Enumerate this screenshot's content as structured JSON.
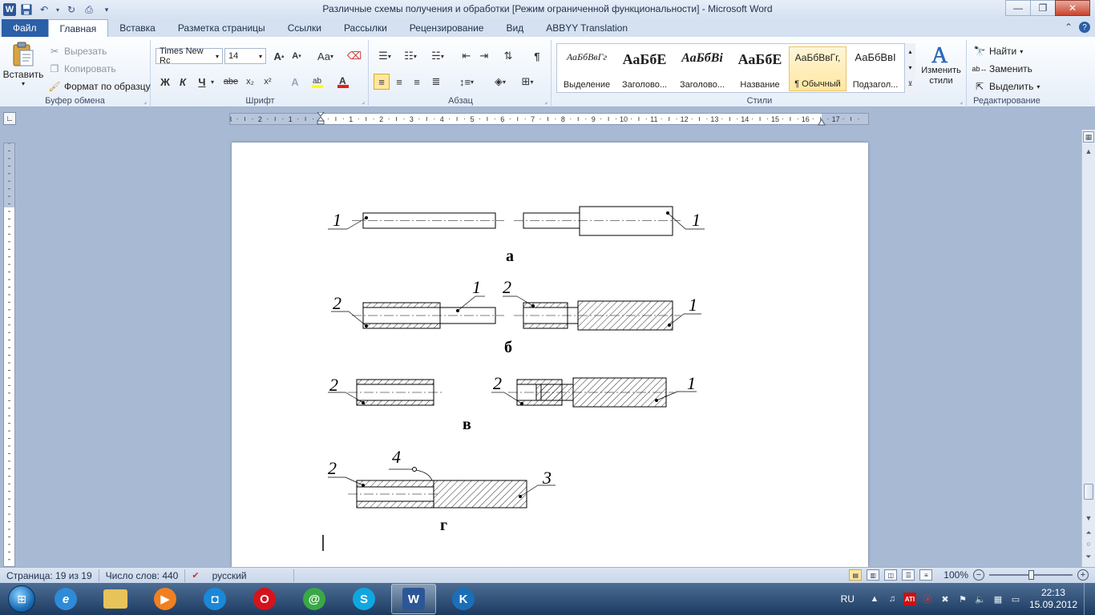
{
  "window": {
    "title": "Различные схемы получения и обработки [Режим ограниченной функциональности]  -  Microsoft Word",
    "app_icon_letter": "W",
    "controls": {
      "minimize": "—",
      "maximize": "❐",
      "close": "✕"
    }
  },
  "tabs": {
    "file": "Файл",
    "items": [
      "Главная",
      "Вставка",
      "Разметка страницы",
      "Ссылки",
      "Рассылки",
      "Рецензирование",
      "Вид",
      "ABBYY Translation"
    ],
    "active": "Главная"
  },
  "ribbon": {
    "clipboard": {
      "label": "Буфер обмена",
      "paste": "Вставить",
      "cut": "Вырезать",
      "copy": "Копировать",
      "format_painter": "Формат по образцу"
    },
    "font": {
      "label": "Шрифт",
      "font_name": "Times New Rc",
      "font_size": "14",
      "grow": "A",
      "shrink": "A",
      "case": "Aa",
      "bold": "Ж",
      "italic": "К",
      "underline": "Ч",
      "strike": "abe",
      "subscript": "x₂",
      "superscript": "x²"
    },
    "paragraph": {
      "label": "Абзац"
    },
    "styles": {
      "label": "Стили",
      "items": [
        {
          "preview": "АаБбВвГг",
          "name": "Выделение"
        },
        {
          "preview": "АаБбЕ",
          "name": "Заголово..."
        },
        {
          "preview": "АаБбВі",
          "name": "Заголово..."
        },
        {
          "preview": "АаБбЕ",
          "name": "Название"
        },
        {
          "preview": "АаБбВвГг,",
          "name": "¶ Обычный"
        },
        {
          "preview": "АаБбВвІ",
          "name": "Подзагол..."
        }
      ],
      "change_styles": "Изменить стили"
    },
    "editing": {
      "label": "Редактирование",
      "find": "Найти",
      "replace": "Заменить",
      "select": "Выделить"
    }
  },
  "ruler": {
    "numbers": [
      "3",
      "2",
      "1",
      "1",
      "2",
      "3",
      "4",
      "5",
      "6",
      "7",
      "8",
      "9",
      "10",
      "11",
      "12",
      "13",
      "14",
      "15",
      "16",
      "17"
    ]
  },
  "document": {
    "labels": {
      "a": "а",
      "b": "б",
      "v": "в",
      "g": "г",
      "n1": "1",
      "n2": "2",
      "n3": "3",
      "n4": "4"
    }
  },
  "status": {
    "page": "Страница: 19 из 19",
    "words": "Число слов: 440",
    "language": "русский",
    "zoom": "100%",
    "zoom_level": 100
  },
  "taskbar": {
    "language": "RU",
    "time": "22:13",
    "date": "15.09.2012"
  }
}
